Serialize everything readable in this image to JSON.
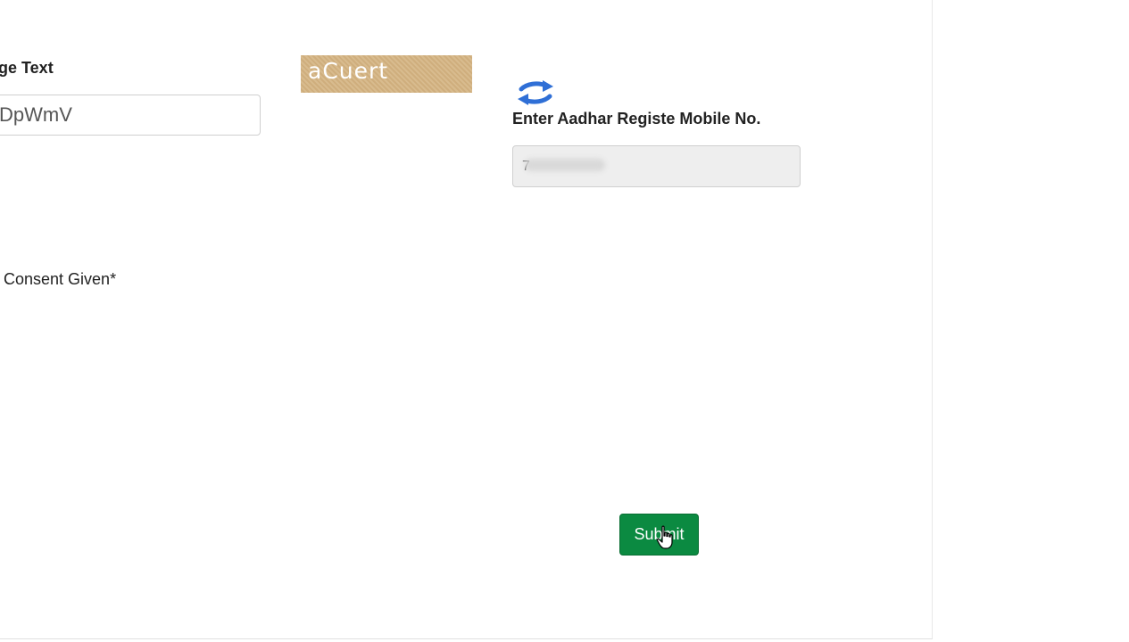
{
  "form": {
    "captcha_label": "ge Text",
    "captcha_input_value": "DpWmV",
    "captcha_image_text": "aCuert",
    "refresh_icon": "refresh-icon",
    "mobile_label": "Enter Aadhar Registe Mobile No.",
    "mobile_input_value": "7",
    "consent_label": "Consent Given*",
    "submit_label": "Submit"
  },
  "colors": {
    "submit_bg": "#0b8a41",
    "captcha_bg": "#d8bb8e",
    "refresh_icon": "#2f6fd6"
  }
}
